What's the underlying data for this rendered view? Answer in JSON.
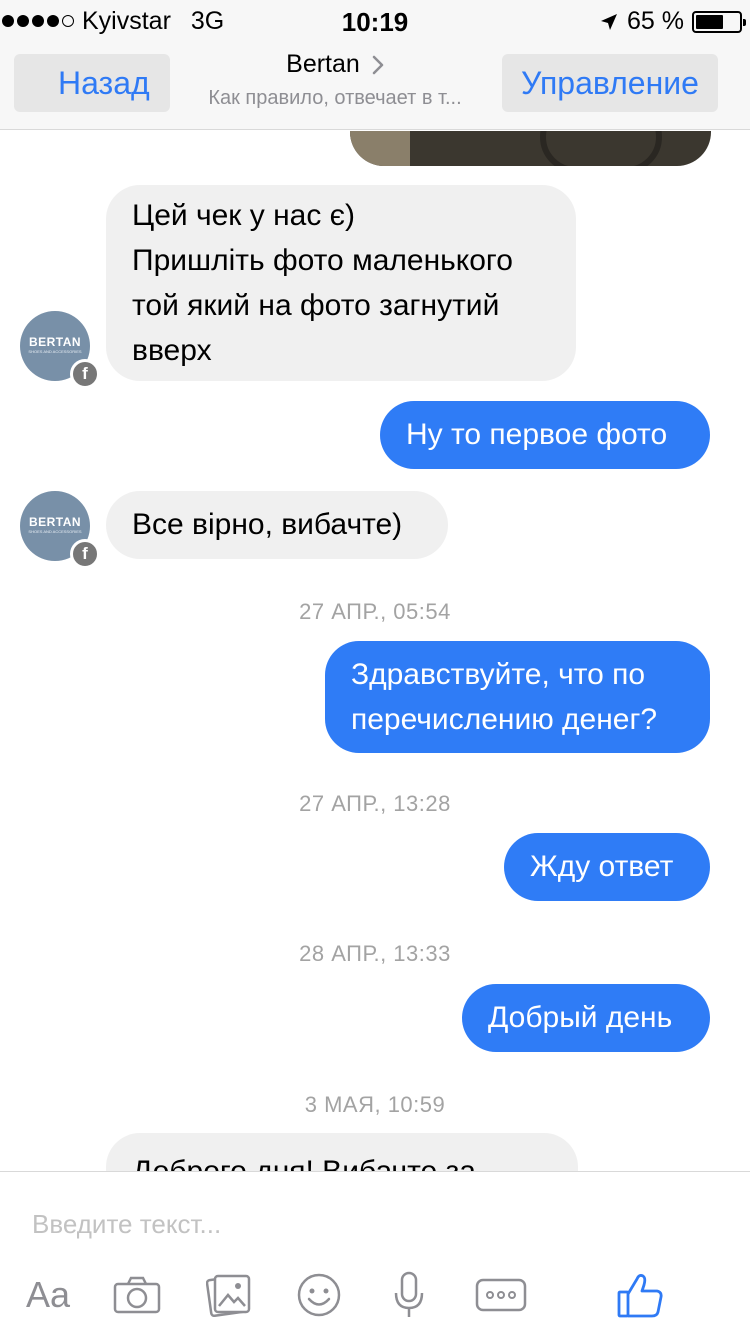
{
  "status_bar": {
    "carrier": "Kyivstar",
    "network": "3G",
    "time": "10:19",
    "battery_percent": "65 %",
    "battery_level": 0.65,
    "signal_bars": 4
  },
  "header": {
    "back_label": "Назад",
    "title": "Bertan",
    "subtitle": "Как правило, отвечает в т...",
    "manage_label": "Управление"
  },
  "messages": [
    {
      "from": "them",
      "lines": [
        "Цей чек у нас є)",
        "Пришліть фото маленького",
        "той який на фото загнутий",
        "вверх"
      ]
    },
    {
      "from": "me",
      "lines": [
        "Ну то первое фото"
      ]
    },
    {
      "from": "them",
      "lines": [
        "Все вірно, вибачте)"
      ]
    },
    {
      "timestamp": "27 АПР., 05:54"
    },
    {
      "from": "me",
      "lines": [
        "Здравствуйте, что по",
        "перечислению денег?"
      ]
    },
    {
      "timestamp": "27 АПР., 13:28"
    },
    {
      "from": "me",
      "lines": [
        "Жду ответ"
      ]
    },
    {
      "timestamp": "28 АПР., 13:33"
    },
    {
      "from": "me",
      "lines": [
        "Добрый день"
      ]
    },
    {
      "timestamp": "3 МАЯ, 10:59"
    },
    {
      "from": "them",
      "lines": [
        "Доброго дня! Вибачте за"
      ]
    }
  ],
  "avatar": {
    "brand": "BERTAN",
    "tagline": "SHOES AND ACCESSORIES",
    "badge": "f"
  },
  "composer": {
    "placeholder": "Введите текст...",
    "text_format_label": "Aa",
    "icons": [
      "text-format-icon",
      "camera-icon",
      "gallery-icon",
      "emoji-icon",
      "microphone-icon",
      "more-icon",
      "like-icon"
    ]
  },
  "colors": {
    "accent": "#2f7af5",
    "outgoing_bubble": "#2f7cf6",
    "incoming_bubble": "#f0f0f0",
    "timestamp": "#a3a3a3"
  }
}
